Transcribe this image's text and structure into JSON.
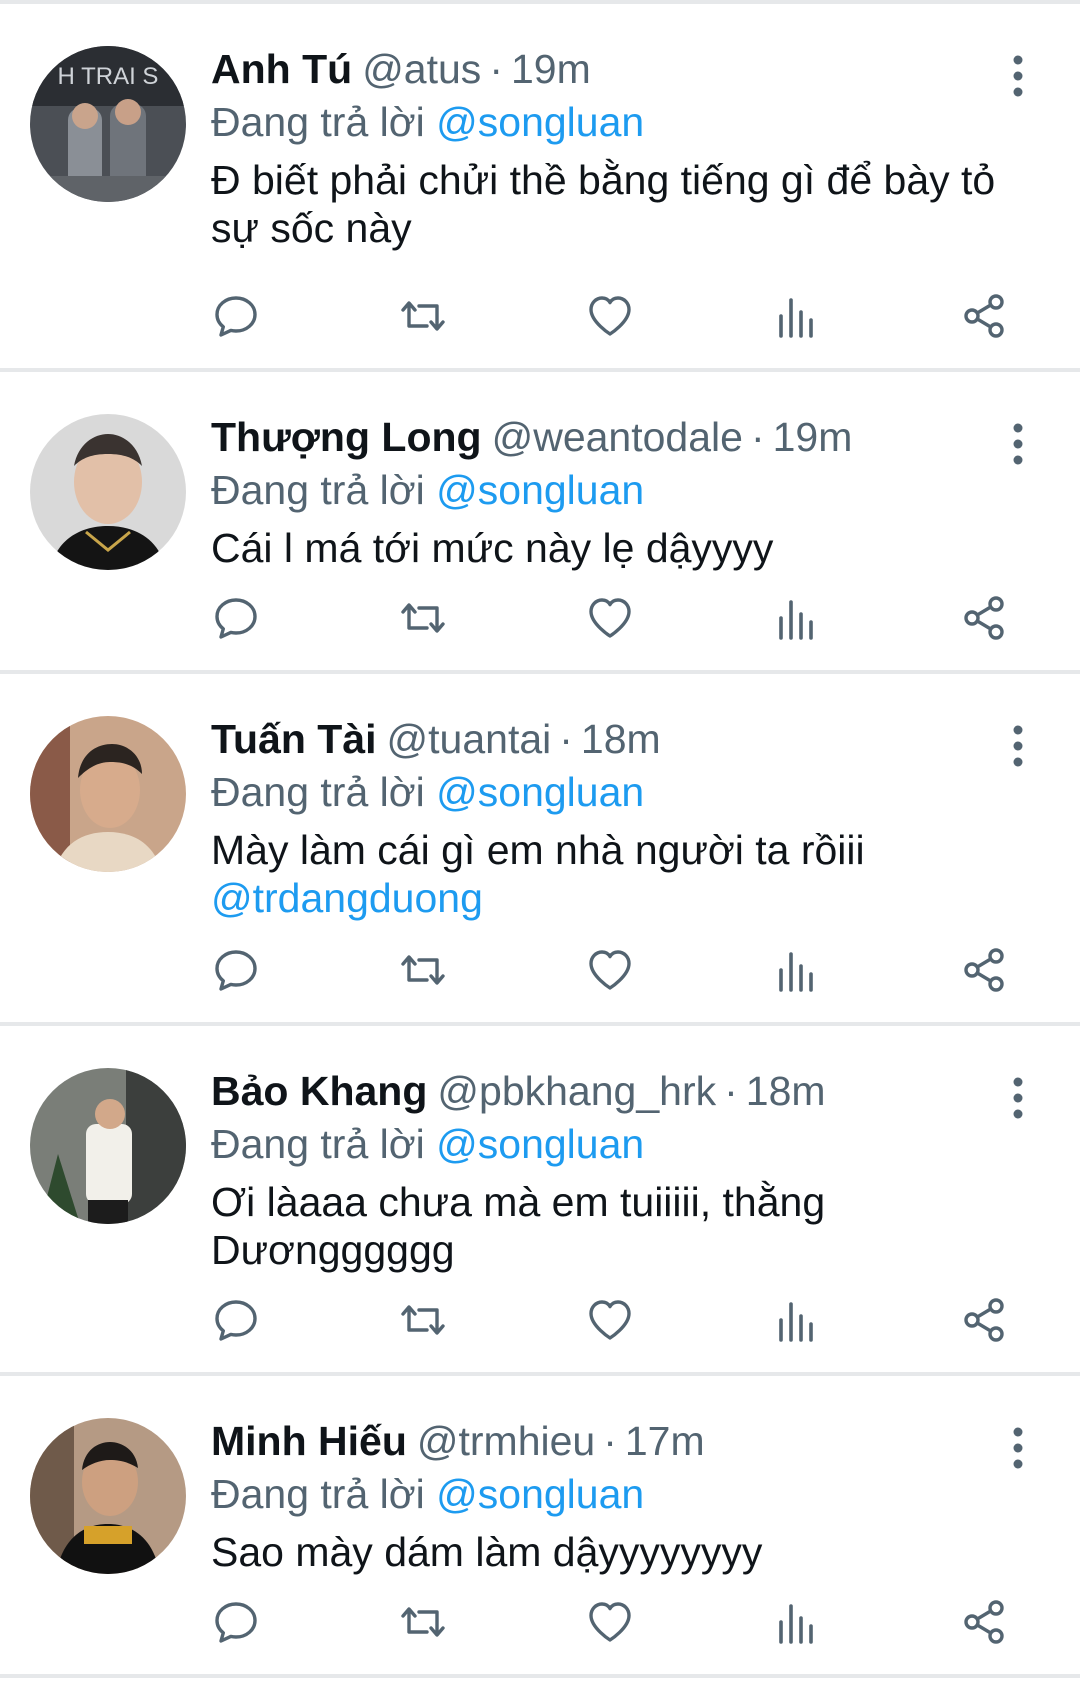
{
  "replies": [
    {
      "name": "Anh Tú",
      "handle": "@atus",
      "sep": "·",
      "time": "19m",
      "reply_prefix": "Đang trả lời",
      "reply_to": "@songluan",
      "text": "Đ biết phải chửi thề bằng tiếng gì để bày tỏ sự sốc này",
      "avatar_caption": "H TRAI S"
    },
    {
      "name": "Thượng Long",
      "handle": "@weantodale",
      "sep": "·",
      "time": "19m",
      "reply_prefix": "Đang trả lời",
      "reply_to": "@songluan",
      "text": "Cái l má tới mức này lẹ dậyyyy"
    },
    {
      "name": "Tuấn Tài",
      "handle": "@tuantai",
      "sep": "·",
      "time": "18m",
      "reply_prefix": "Đang trả lời",
      "reply_to": "@songluan",
      "text": "Mày làm cái gì em nhà người ta rồiii",
      "text_mention": "@trdangduong"
    },
    {
      "name": "Bảo Khang",
      "handle": "@pbkhang_hrk",
      "sep": "·",
      "time": "18m",
      "reply_prefix": "Đang trả lời",
      "reply_to": "@songluan",
      "text": "Ơi làaaa chưa mà em tuiiiii, thằng Dươngggggg"
    },
    {
      "name": "Minh Hiếu",
      "handle": "@trmhieu",
      "sep": "·",
      "time": "17m",
      "reply_prefix": "Đang trả lời",
      "reply_to": "@songluan",
      "text": "Sao mày dám làm dậyyyyyyyy"
    }
  ],
  "icons": {
    "reply": "comment-bubble-icon",
    "retweet": "retweet-arrows-icon",
    "like": "heart-icon",
    "views": "bar-chart-icon",
    "share": "share-nodes-icon",
    "more": "vertical-dots-icon"
  },
  "colors": {
    "accent": "#1d9bf0",
    "secondary_text": "#536471",
    "primary_text": "#0f1419",
    "icon": "#536471",
    "divider": "#e6e8ea"
  }
}
